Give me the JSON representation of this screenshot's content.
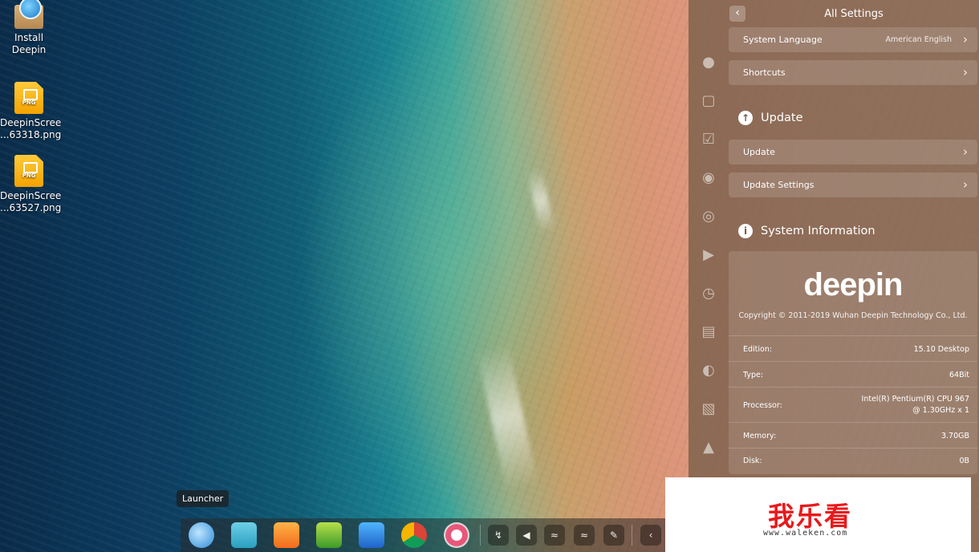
{
  "desktop": {
    "icons": [
      {
        "label_line1": "Install",
        "label_line2": "Deepin"
      },
      {
        "label_line1": "DeepinScree",
        "label_line2": "...63318.png",
        "badge": "PNG"
      },
      {
        "label_line1": "DeepinScree",
        "label_line2": "...63527.png",
        "badge": "PNG"
      }
    ]
  },
  "settings": {
    "title": "All Settings",
    "rows": {
      "system_language": {
        "label": "System Language",
        "value": "American English"
      },
      "shortcuts": {
        "label": "Shortcuts"
      },
      "update": {
        "label": "Update"
      },
      "update_settings": {
        "label": "Update Settings"
      }
    },
    "sections": {
      "update": "Update",
      "system_information": "System Information"
    },
    "system_info": {
      "logo": "deepin",
      "copyright": "Copyright © 2011-2019 Wuhan Deepin Technology Co., Ltd.",
      "edition": {
        "key": "Edition:",
        "value": "15.10 Desktop"
      },
      "type": {
        "key": "Type:",
        "value": "64Bit"
      },
      "processor": {
        "key": "Processor:",
        "value_line1": "Intel(R) Pentium(R) CPU 967",
        "value_line2": "@ 1.30GHz x 1"
      },
      "memory": {
        "key": "Memory:",
        "value": "3.70GB"
      },
      "disk": {
        "key": "Disk:",
        "value": "0B"
      }
    }
  },
  "dock": {
    "tooltip": "Launcher",
    "apps": [
      "launcher-icon",
      "store-icon",
      "app-store-icon",
      "music-icon",
      "video-icon",
      "chrome-icon",
      "settings-icon"
    ],
    "tray": [
      "usb-icon",
      "volume-icon",
      "wifi-icon",
      "wifi-icon",
      "pen-icon",
      "collapse-icon"
    ]
  },
  "watermark": {
    "text": "我乐看",
    "url": "www.waleken.com"
  }
}
